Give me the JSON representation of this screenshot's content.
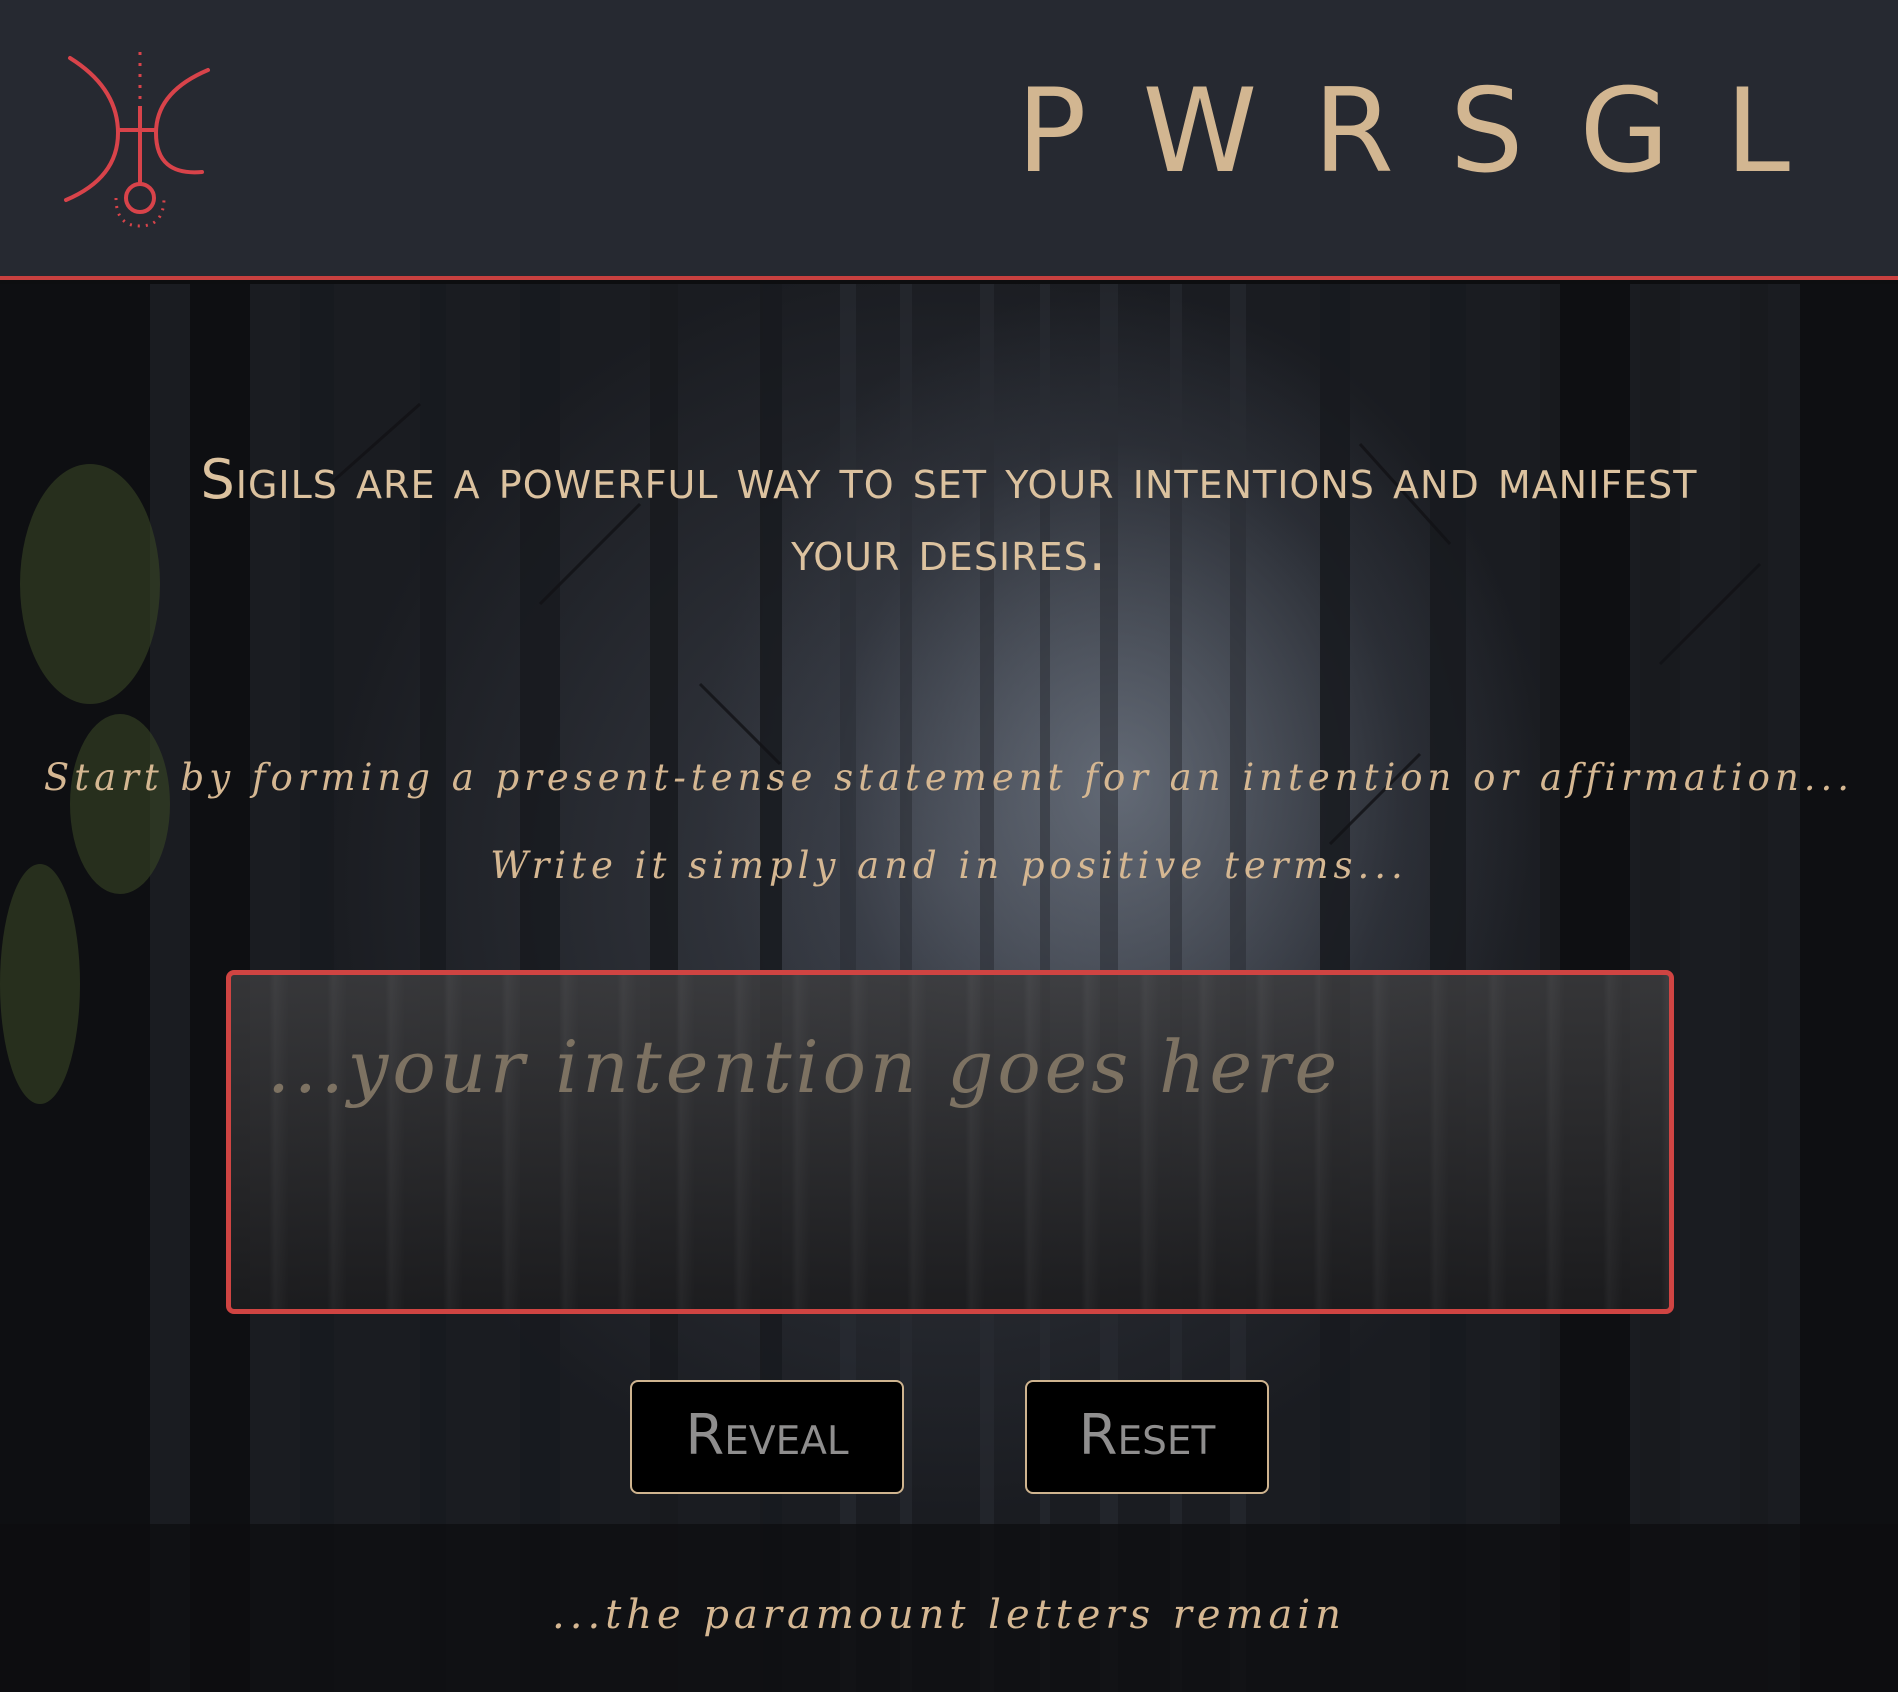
{
  "header": {
    "brand": "PWRSGL",
    "logo_icon": "sigil-glyph-icon"
  },
  "main": {
    "headline": "Sigils are a powerful way to set your intentions and manifest your desires.",
    "instruction_1": "Start by forming a present-tense statement for an intention or affirmation...",
    "instruction_2": "Write it simply and in positive terms...",
    "intention_input": {
      "placeholder": "...your intention goes here",
      "value": ""
    },
    "buttons": {
      "reveal": "Reveal",
      "reset": "Reset"
    },
    "footer_text": "...the paramount letters remain"
  },
  "colors": {
    "header_bg": "#262931",
    "accent_red": "#c8403f",
    "gold": "#d2b691",
    "button_bg": "#000000"
  }
}
